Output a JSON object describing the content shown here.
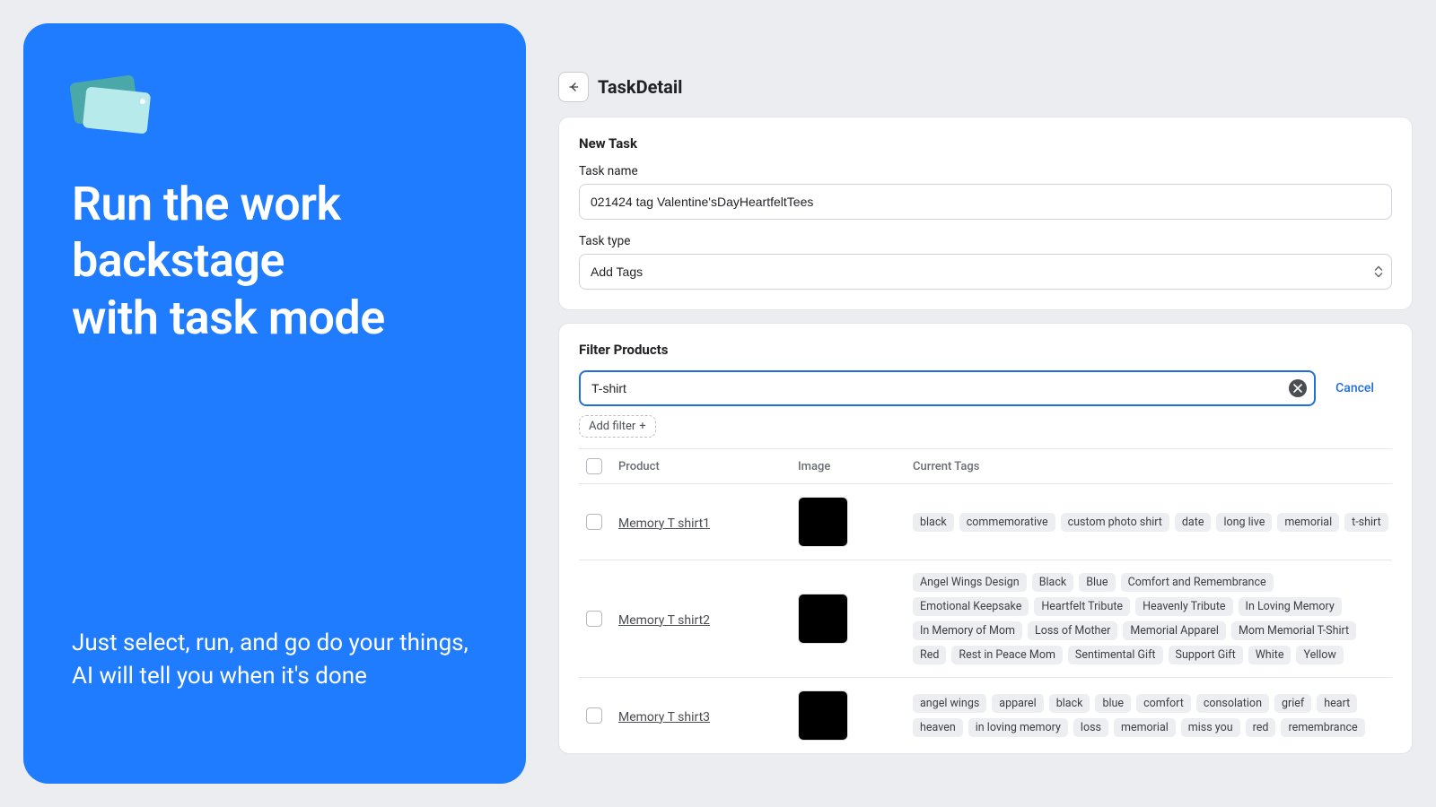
{
  "left": {
    "headline_line1": "Run the work",
    "headline_line2": "backstage",
    "headline_line3": "with task mode",
    "subtext": "Just select, run, and go do your things, AI will tell you when it's done"
  },
  "header": {
    "title": "TaskDetail"
  },
  "task_card": {
    "title": "New Task",
    "name_label": "Task name",
    "name_value": "021424 tag Valentine'sDayHeartfeltTees",
    "type_label": "Task type",
    "type_value": "Add Tags"
  },
  "filter": {
    "title": "Filter Products",
    "search_value": "T-shirt",
    "cancel_label": "Cancel",
    "add_filter_label": "Add filter",
    "columns": {
      "product": "Product",
      "image": "Image",
      "tags": "Current Tags"
    },
    "rows": [
      {
        "name": "Memory T shirt1",
        "tags": [
          "black",
          "commemorative",
          "custom photo shirt",
          "date",
          "long live",
          "memorial",
          "t-shirt"
        ]
      },
      {
        "name": "Memory T shirt2",
        "tags": [
          "Angel Wings Design",
          "Black",
          "Blue",
          "Comfort and Remembrance",
          "Emotional Keepsake",
          "Heartfelt Tribute",
          "Heavenly Tribute",
          "In Loving Memory",
          "In Memory of Mom",
          "Loss of Mother",
          "Memorial Apparel",
          "Mom Memorial T-Shirt",
          "Red",
          "Rest in Peace Mom",
          "Sentimental Gift",
          "Support Gift",
          "White",
          "Yellow"
        ]
      },
      {
        "name": "Memory T shirt3",
        "tags": [
          "angel wings",
          "apparel",
          "black",
          "blue",
          "comfort",
          "consolation",
          "grief",
          "heart",
          "heaven",
          "in loving memory",
          "loss",
          "memorial",
          "miss you",
          "red",
          "remembrance"
        ]
      }
    ]
  }
}
